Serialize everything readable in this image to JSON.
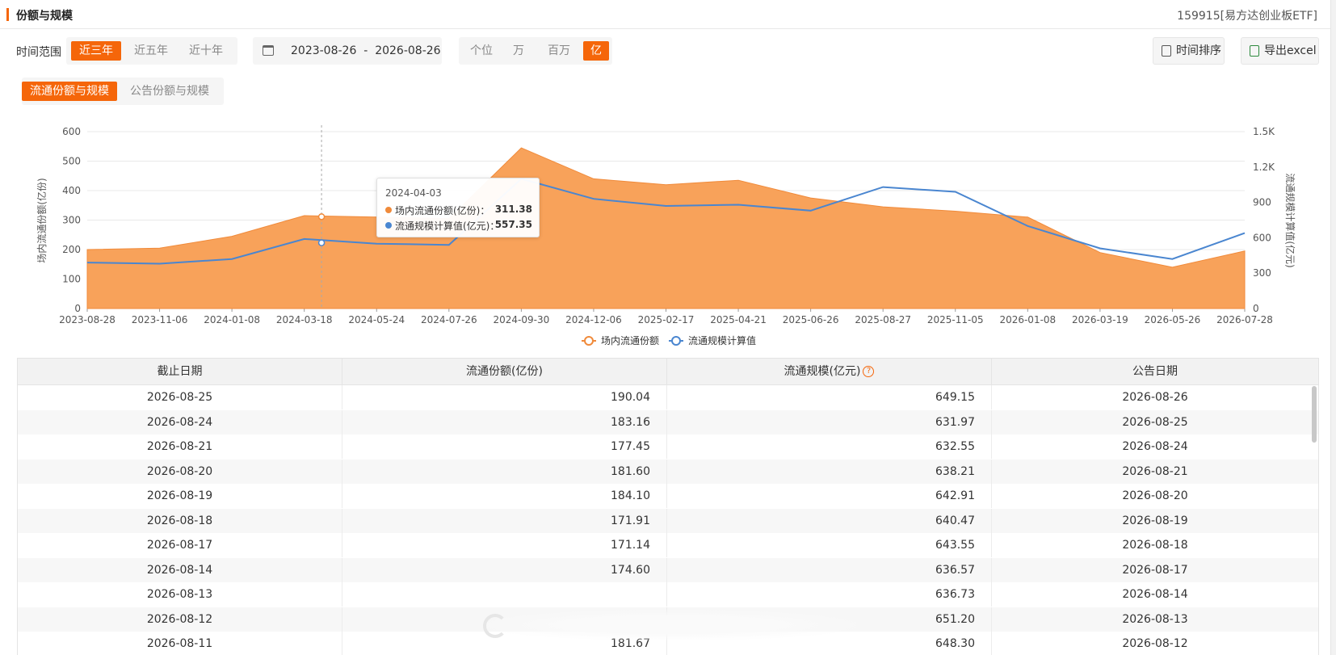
{
  "header": {
    "title": "份额与规模",
    "fund": "159915[易方达创业板ETF]"
  },
  "range": {
    "label": "时间范围",
    "options": [
      "近三年",
      "近五年",
      "近十年"
    ],
    "selected": "近三年"
  },
  "date_range": {
    "text": "2023-08-26  -  2026-08-26"
  },
  "unit": {
    "options": [
      "个位",
      "万",
      "百万",
      "亿"
    ],
    "selected": "亿"
  },
  "buttons": {
    "sort": "时间排序",
    "export": "导出excel"
  },
  "tabs": {
    "items": [
      "流通份额与规模",
      "公告份额与规模"
    ],
    "selected": "流通份额与规模"
  },
  "tooltip": {
    "date": "2024-04-03",
    "s1_name": "场内流通份额(亿份)：",
    "s1_value": "311.38",
    "s2_name": "流通规模计算值(亿元)：",
    "s2_value": "557.35"
  },
  "colors": {
    "accent": "#f5660a",
    "area": "#f8a25a",
    "line": "#4a86d0"
  },
  "chart_data": {
    "type": "area",
    "x": [
      "2023-08-28",
      "2023-11-06",
      "2024-01-08",
      "2024-03-18",
      "2024-05-24",
      "2024-07-26",
      "2024-09-30",
      "2024-12-06",
      "2025-02-17",
      "2025-04-21",
      "2025-06-26",
      "2025-08-27",
      "2025-11-05",
      "2026-01-08",
      "2026-03-19",
      "2026-05-26",
      "2026-07-28"
    ],
    "series": [
      {
        "name": "场内流通份额",
        "axis": "left",
        "type": "area",
        "values": [
          200,
          205,
          245,
          315,
          310,
          305,
          545,
          440,
          420,
          435,
          375,
          345,
          330,
          310,
          190,
          140,
          195
        ]
      },
      {
        "name": "流通规模计算值",
        "axis": "right",
        "type": "line",
        "values": [
          390,
          380,
          420,
          590,
          550,
          540,
          1100,
          930,
          870,
          880,
          830,
          1030,
          990,
          700,
          510,
          420,
          640
        ]
      }
    ],
    "ylim_left": [
      0,
      600
    ],
    "yticks_left": [
      0,
      100,
      200,
      300,
      400,
      500,
      600
    ],
    "ylim_right": [
      0,
      1500
    ],
    "yticks_right_labels": [
      "0",
      "300",
      "600",
      "900",
      "1.2K",
      "1.5K"
    ],
    "ylabel_left": "场内流通份额(亿份)",
    "ylabel_right": "流通规模计算值(亿元)",
    "legend": [
      "场内流通份额",
      "流通规模计算值"
    ],
    "legend_position": "bottom",
    "grid": true
  },
  "table": {
    "headers": [
      "截止日期",
      "流通份额(亿份)",
      "流通规模(亿元)",
      "公告日期"
    ],
    "rows": [
      [
        "2026-08-25",
        "190.04",
        "649.15",
        "2026-08-26"
      ],
      [
        "2026-08-24",
        "183.16",
        "631.97",
        "2026-08-25"
      ],
      [
        "2026-08-21",
        "177.45",
        "632.55",
        "2026-08-24"
      ],
      [
        "2026-08-20",
        "181.60",
        "638.21",
        "2026-08-21"
      ],
      [
        "2026-08-19",
        "184.10",
        "642.91",
        "2026-08-20"
      ],
      [
        "2026-08-18",
        "171.91",
        "640.47",
        "2026-08-19"
      ],
      [
        "2026-08-17",
        "171.14",
        "643.55",
        "2026-08-18"
      ],
      [
        "2026-08-14",
        "174.60",
        "636.57",
        "2026-08-17"
      ],
      [
        "2026-08-13",
        "",
        "636.73",
        "2026-08-14"
      ],
      [
        "2026-08-12",
        "",
        "651.20",
        "2026-08-13"
      ],
      [
        "2026-08-11",
        "181.67",
        "648.30",
        "2026-08-12"
      ]
    ]
  }
}
